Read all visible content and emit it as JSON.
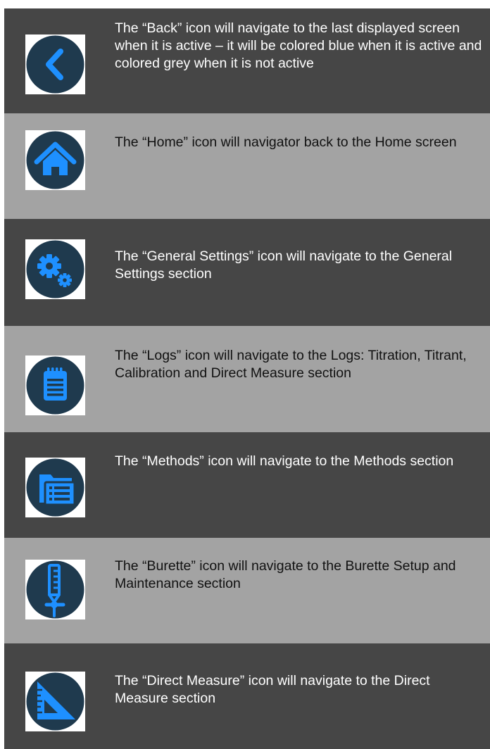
{
  "colors": {
    "dark_row": "#464646",
    "light_row": "#a3a3a3",
    "icon_circle": "#1f3a4e",
    "icon_accent": "#1e90ff"
  },
  "rows": [
    {
      "icon": "back-icon",
      "text": "The “Back” icon will navigate to the last displayed screen when it is active – it will be colored blue when it is active and colored grey when it is not active"
    },
    {
      "icon": "home-icon",
      "text": "The “Home” icon will navigator back to the Home screen"
    },
    {
      "icon": "gear-icon",
      "text": "The “General Settings” icon will navigate to the General Settings section"
    },
    {
      "icon": "logs-icon",
      "text": "The “Logs” icon will navigate to the Logs: Titration, Titrant, Calibration and Direct Measure section"
    },
    {
      "icon": "methods-icon",
      "text": "The “Methods” icon will navigate to the Methods section"
    },
    {
      "icon": "burette-icon",
      "text": "The “Burette” icon will navigate to the Burette Setup and Maintenance section"
    },
    {
      "icon": "direct-measure-icon",
      "text": "The “Direct Measure” icon will navigate to the Direct Measure section"
    }
  ]
}
